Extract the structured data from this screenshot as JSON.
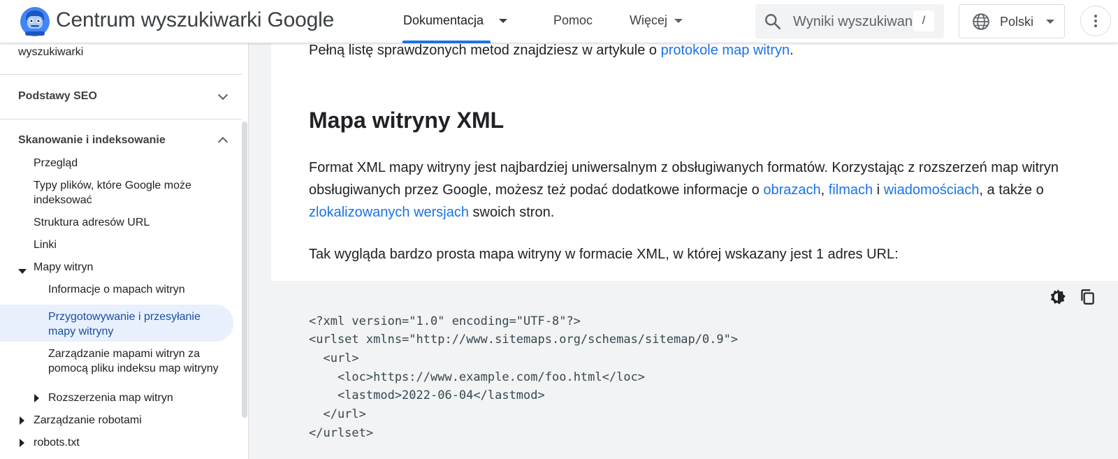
{
  "header": {
    "site_title": "Centrum wyszukiwarki Google",
    "nav": [
      {
        "label": "Dokumentacja"
      },
      {
        "label": "Pomoc"
      },
      {
        "label": "Więcej"
      }
    ],
    "search": {
      "placeholder": "Wyniki wyszukiwania",
      "shortcut": "/"
    },
    "language": {
      "label": "Polski"
    },
    "icons": {
      "logo": "google-search-central-logo",
      "search": "search-icon",
      "globe": "globe-icon",
      "more": "more-vert-icon"
    },
    "accent_color": "#1a73e8"
  },
  "sidebar": {
    "top_partial": "wyszukiwarki",
    "sections": [
      {
        "label": "Podstawy SEO",
        "expanded": false
      },
      {
        "label": "Skanowanie i indeksowanie",
        "expanded": true
      }
    ],
    "items": [
      {
        "label": "Przegląd"
      },
      {
        "label": "Typy plików, które Google może indeksować"
      },
      {
        "label": "Struktura adresów URL"
      },
      {
        "label": "Linki"
      },
      {
        "label": "Mapy witryn"
      },
      {
        "label": "Informacje o mapach witryn"
      },
      {
        "label": "Przygotowywanie i przesyłanie mapy witryny",
        "active": true
      },
      {
        "label": "Zarządzanie mapami witryn za pomocą pliku indeksu map witryny"
      },
      {
        "label": "Rozszerzenia map witryn"
      },
      {
        "label": "Zarządzanie robotami"
      },
      {
        "label": "robots.txt"
      }
    ]
  },
  "main": {
    "intro": {
      "before": "Pełną listę sprawdzonych metod znajdziesz w artykule o ",
      "link": "protokole map witryn",
      "after": "."
    },
    "heading": "Mapa witryny XML",
    "para1": {
      "t1": "Format XML mapy witryny jest najbardziej uniwersalnym z obsługiwanych formatów. Korzystając z rozszerzeń map witryn obsługiwanych przez Google, możesz też podać dodatkowe informacje o ",
      "l1": "obrazach",
      "t2": ", ",
      "l2": "filmach",
      "t3": " i ",
      "l3": "wiadomościach",
      "t4": ", a także o ",
      "l4": "zlokalizowanych wersjach",
      "t5": " swoich stron."
    },
    "para2": "Tak wygląda bardzo prosta mapa witryny w formacie XML, w której wskazany jest 1 adres URL:",
    "code": {
      "lines": [
        "<?xml version=\"1.0\" encoding=\"UTF-8\"?>",
        "<urlset xmlns=\"http://www.sitemaps.org/schemas/sitemap/0.9\">",
        "  <url>",
        "    <loc>https://www.example.com/foo.html</loc>",
        "    <lastmod>2022-06-04</lastmod>",
        "  </url>",
        "</urlset>"
      ],
      "tools": [
        "dark-mode-toggle-icon",
        "copy-icon"
      ]
    }
  }
}
